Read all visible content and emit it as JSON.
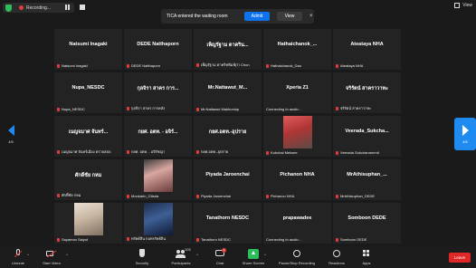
{
  "topbar": {
    "recording_label": "Recording...",
    "view_label": "View"
  },
  "toast": {
    "message": "TICA entered the waiting room",
    "admit_label": "Admit",
    "view_label": "View",
    "close_glyph": "×"
  },
  "nav": {
    "left_page": "4/5",
    "right_page": "4/5"
  },
  "tiles": [
    {
      "name": "Natsumi Inagaki",
      "label": "Natsumi Inagaki",
      "muted": true
    },
    {
      "name": "DEDE Natthaporn",
      "label": "DEDE Natthaporn",
      "muted": true
    },
    {
      "name": "เพ็ญรัฐาม ตาคริน...",
      "label": "เพ็ญรัฐาม ตาคริทพิมพ์(TI Chon",
      "muted": true
    },
    {
      "name": "Hathaichanok_...",
      "label": "Hathaichanok_Dao",
      "muted": true
    },
    {
      "name": "Ateataya NHA",
      "label": "Ateataya NHA",
      "muted": true
    },
    {
      "name": "Nupa_NESDC",
      "label": "Nupa_NESDC",
      "muted": true
    },
    {
      "name": "กุลจิรา สาคร การ...",
      "label": "กุลจิรา สาคร การคลัง",
      "muted": true
    },
    {
      "name": "Mr.Nattawut_M...",
      "label": "Mr.Nattawut Makhuntup",
      "muted": true
    },
    {
      "name": "Xperia Z1",
      "label": "Connecting to audio...",
      "muted": false
    },
    {
      "name": "จริรัตน์ สาคราวาทะ",
      "label": "จริรัตน์ สาคราวาทะ",
      "muted": true
    },
    {
      "name": "เนญจมาศ จันทร์...",
      "label": "เนญจมาศ จันทร์เมือง ตรวจสอบ",
      "muted": true
    },
    {
      "name": "กยศ. อตท. - อจิร์...",
      "label": "กยศ. อตท. - อจิรัชญา",
      "muted": true
    },
    {
      "name": "กยศ.อตท.-อุปราย",
      "label": "กยศ.อตท.-อุปราย",
      "muted": true
    },
    {
      "name": "",
      "label": "Kobchai Meksee",
      "muted": true,
      "photo": "ph1"
    },
    {
      "name": "Veerada_Sukcha...",
      "label": "Veerada Sukcharoenmit",
      "muted": true
    },
    {
      "name": "ศักดิ์ชัย กหม",
      "label": "ศักดิ์ชัย กหม",
      "muted": true
    },
    {
      "name": "",
      "label": "Mookarin_Gitsda",
      "muted": true,
      "photo": "ph2"
    },
    {
      "name": "Piyada Jaroenchai",
      "label": "Piyada Jaroenchai",
      "muted": true
    },
    {
      "name": "Pichanon NHA",
      "label": "Pichanon NHA",
      "muted": true
    },
    {
      "name": "MrAthisuphan_...",
      "label": "MrAthisuphan_DEDE",
      "muted": true
    },
    {
      "name": "",
      "label": "Sayamon Saiyot",
      "muted": true,
      "photo": "ph3"
    },
    {
      "name": "",
      "label": "ทรัพย์สิน กอทรรัพย์สิน",
      "muted": true,
      "photo": "ph4"
    },
    {
      "name": "Tanathorn NESDC",
      "label": "Tanathorn NESDC",
      "muted": true
    },
    {
      "name": "prapawadee",
      "label": "Connecting to audio...",
      "muted": false
    },
    {
      "name": "Somboon DEDE",
      "label": "Somboon DEDE",
      "muted": true
    }
  ],
  "toolbar": {
    "unmute_label": "Unmute",
    "start_video_label": "Start Video",
    "security_label": "Security",
    "participants_label": "Participants",
    "participants_count": "105",
    "chat_label": "Chat",
    "chat_badge": "2",
    "share_label": "Share Screen",
    "record_label": "Pause/Stop Recording",
    "reactions_label": "Reactions",
    "apps_label": "Apps",
    "leave_label": "Leave",
    "caret": "^"
  },
  "colors": {
    "accent": "#0e72ed",
    "share_green": "#2dbd5a",
    "leave_red": "#e02828",
    "muted_red": "#e23b3b"
  }
}
